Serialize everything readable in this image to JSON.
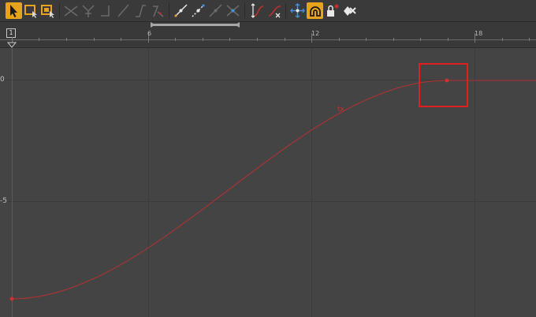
{
  "toolbar": {
    "groups": [
      [
        "select-key-tool-icon",
        "region-select-tool-icon",
        "time-range-tool-icon"
      ],
      [
        "break-tangents-icon",
        "unify-tangents-icon",
        "step-tangent-icon",
        "linear-tangent-icon",
        "clamped-tangent-icon",
        "plateau-tangent-icon"
      ],
      [
        "flat-tangent-icon",
        "spline-tangent-icon",
        "auto-tangent-icon",
        "fixed-tangent-icon"
      ],
      [
        "normalize-curve-icon",
        "denormalize-curve-icon"
      ],
      [
        "snap-keys-icon",
        "magnet-snap-icon",
        "lock-keys-icon",
        "isolate-curve-icon"
      ]
    ],
    "active": "magnet-snap-icon"
  },
  "ruler": {
    "current_frame": "1",
    "tick_labels": [
      "6",
      "12",
      "18"
    ]
  },
  "graph": {
    "y_labels": [
      "0",
      "-5"
    ],
    "curve_label": "tx",
    "curve_color": "#b83030",
    "highlight_color": "#e02020"
  }
}
